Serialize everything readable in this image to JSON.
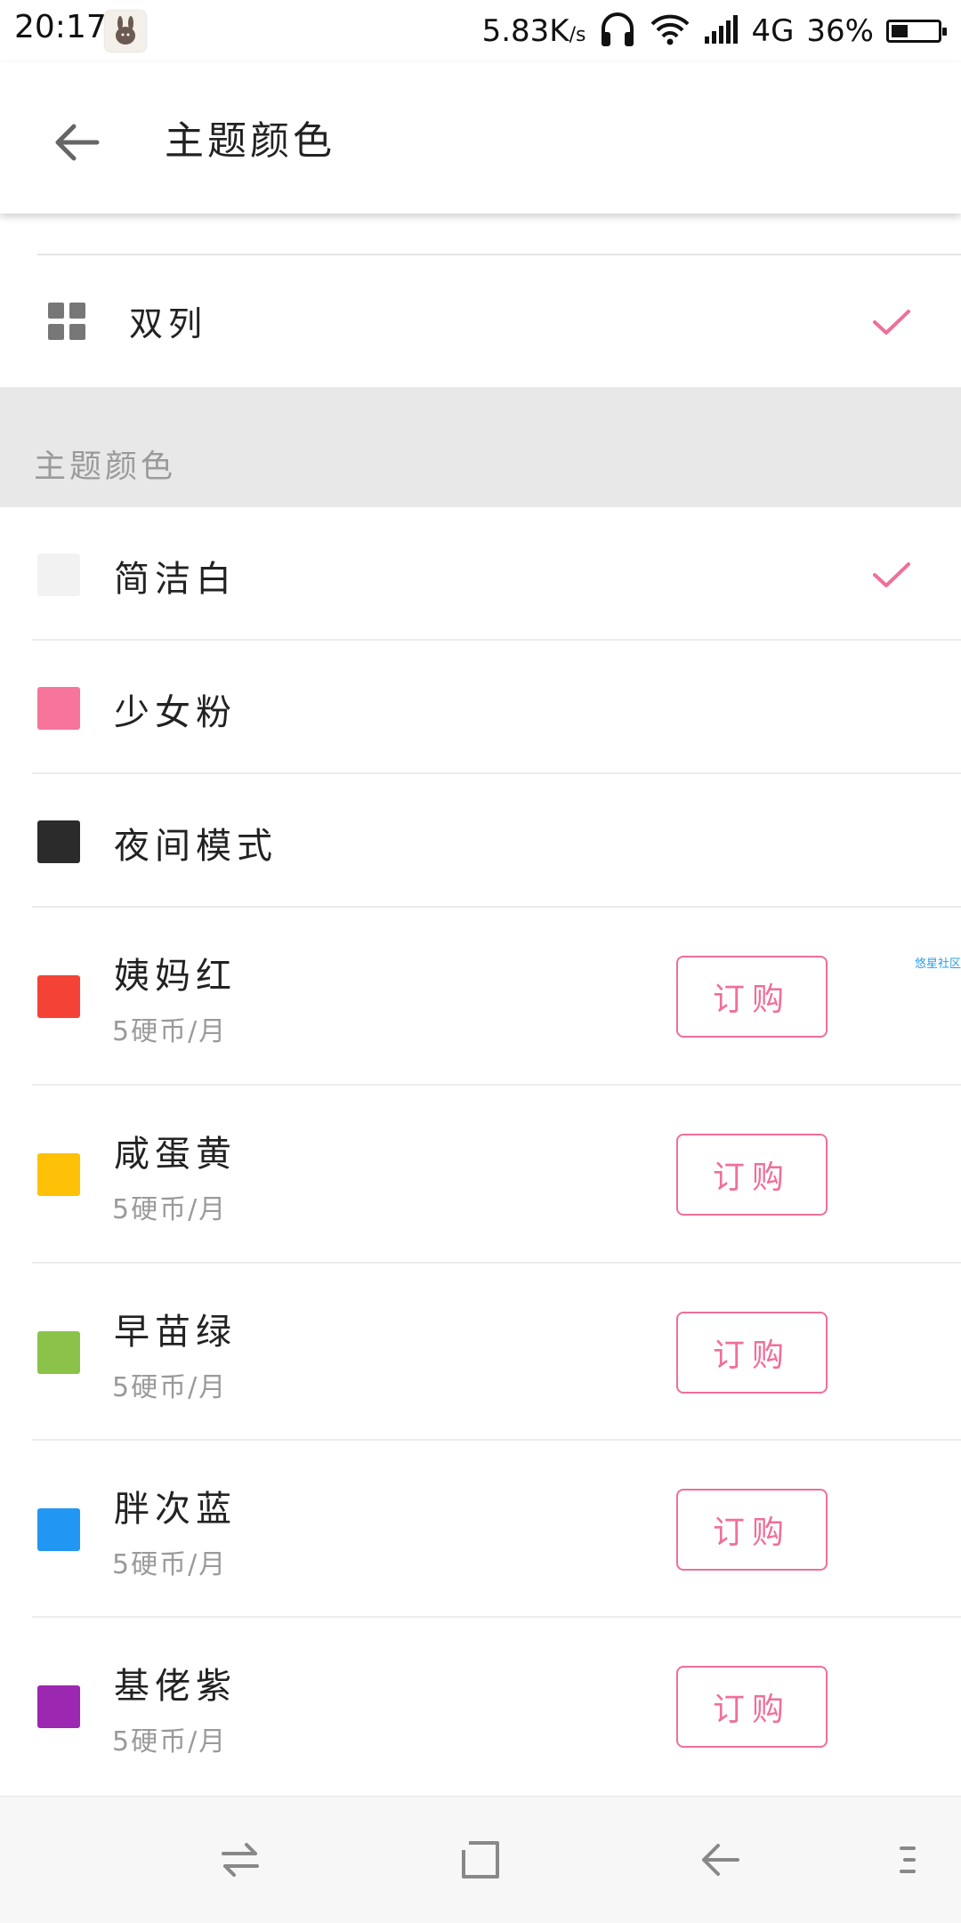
{
  "status_bar": {
    "time": "20:17",
    "net_speed": "5.83K",
    "net_speed_unit": "/s",
    "network": "4G",
    "battery": "36%",
    "battery_level": 0.36
  },
  "toolbar": {
    "title": "主题颜色"
  },
  "layout_option": {
    "label": "双列",
    "selected": true
  },
  "section": {
    "title": "主题颜色"
  },
  "themes": [
    {
      "name": "简洁白",
      "color": "#f2f2f2",
      "selected": true
    },
    {
      "name": "少女粉",
      "color": "#f7749b"
    },
    {
      "name": "夜间模式",
      "color": "#2b2b2b"
    },
    {
      "name": "姨妈红",
      "color": "#f44336",
      "price": "5硬币/月",
      "action": "订购"
    },
    {
      "name": "咸蛋黄",
      "color": "#ffc107",
      "price": "5硬币/月",
      "action": "订购"
    },
    {
      "name": "早苗绿",
      "color": "#8bc34a",
      "price": "5硬币/月",
      "action": "订购"
    },
    {
      "name": "胖次蓝",
      "color": "#2196f3",
      "price": "5硬币/月",
      "action": "订购"
    },
    {
      "name": "基佬紫",
      "color": "#9c27b0",
      "price": "5硬币/月",
      "action": "订购"
    }
  ],
  "watermark": "悠星社区",
  "colors": {
    "accent": "#ef6f9a",
    "section_bg": "#e8e8e8"
  },
  "nav_icons": [
    "switch-icon",
    "home-icon",
    "back-icon",
    "menu-icon"
  ]
}
